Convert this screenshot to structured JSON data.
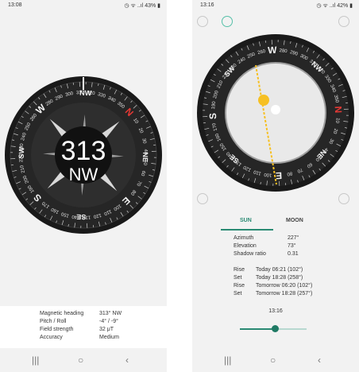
{
  "left": {
    "status": {
      "time": "13:08",
      "indicators": "◷ ᯤ ..ıl 43% ▮"
    },
    "compass": {
      "heading_degrees": "313",
      "heading_cardinal": "NW",
      "cardinals": [
        "N",
        "NE",
        "E",
        "SE",
        "S",
        "SW",
        "W",
        "NW"
      ],
      "needle_color": "#e53935"
    },
    "info": [
      {
        "label": "Magnetic heading",
        "value": "313° NW"
      },
      {
        "label": "Pitch / Roll",
        "value": "-4° / -9°"
      },
      {
        "label": "Field strength",
        "value": "32 μT"
      },
      {
        "label": "Accuracy",
        "value": "Medium"
      }
    ]
  },
  "right": {
    "status": {
      "time": "13:16",
      "indicators": "◷ ᯤ ..ıl 42% ▮"
    },
    "top_icons": [
      "settings-icon",
      "compass-mode-icon",
      "add-icon"
    ],
    "bottom_icons": [
      "camera-icon",
      "chevron-down-icon"
    ],
    "tabs": [
      "SUN",
      "MOON"
    ],
    "sun": {
      "azimuth_label": "Azimuth",
      "azimuth": "227°",
      "elevation_label": "Elevation",
      "elevation": "73°",
      "shadow_label": "Shadow ratio",
      "shadow": "0.31",
      "events": [
        {
          "type": "Rise",
          "when": "Today 06:21 (102°)"
        },
        {
          "type": "Set",
          "when": "Today 18:28 (258°)"
        },
        {
          "type": "Rise",
          "when": "Tomorrow 06:20 (102°)"
        },
        {
          "type": "Set",
          "when": "Tomorrow 18:28 (257°)"
        }
      ]
    },
    "slider": {
      "time": "13:16",
      "position_fraction": 0.55
    },
    "colors": {
      "accent": "#2a8a73",
      "sun": "#f6c023"
    }
  }
}
